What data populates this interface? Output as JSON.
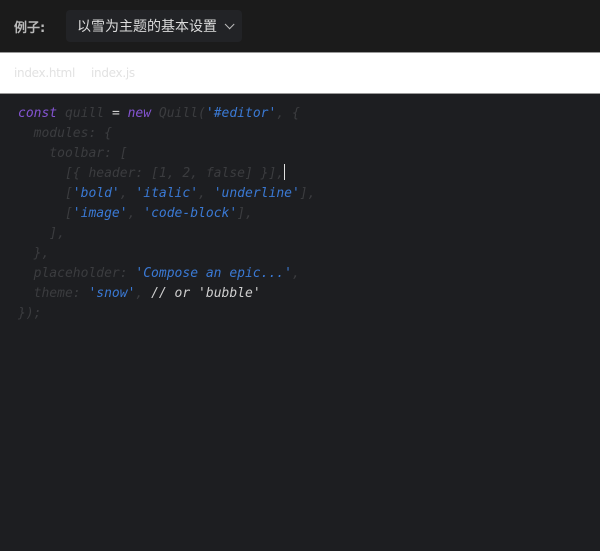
{
  "header": {
    "label": "例子:",
    "select_value": "以雪为主题的基本设置"
  },
  "tabs": [
    {
      "label": "index.html"
    },
    {
      "label": "index.js"
    }
  ],
  "code_lines": [
    [
      [
        "kw",
        "const"
      ],
      [
        "dim",
        " quill "
      ],
      [
        "op",
        "= "
      ],
      [
        "kw",
        "new"
      ],
      [
        "dim",
        " Quill("
      ],
      [
        "str",
        "'#editor'"
      ],
      [
        "dim",
        ", {"
      ]
    ],
    [
      [
        "dim",
        "  modules: {"
      ]
    ],
    [
      [
        "dim",
        "    toolbar: ["
      ]
    ],
    [
      [
        "dim",
        "      [{ header: [1, 2, false] }],"
      ],
      [
        "cursor",
        ""
      ]
    ],
    [
      [
        "dim",
        "      ["
      ],
      [
        "str",
        "'bold'"
      ],
      [
        "dim",
        ", "
      ],
      [
        "str",
        "'italic'"
      ],
      [
        "dim",
        ", "
      ],
      [
        "str",
        "'underline'"
      ],
      [
        "dim",
        "],"
      ]
    ],
    [
      [
        "dim",
        "      ["
      ],
      [
        "str",
        "'image'"
      ],
      [
        "dim",
        ", "
      ],
      [
        "str",
        "'code-block'"
      ],
      [
        "dim",
        "],"
      ]
    ],
    [
      [
        "dim",
        "    ],"
      ]
    ],
    [
      [
        "dim",
        "  },"
      ]
    ],
    [
      [
        "dim",
        "  placeholder: "
      ],
      [
        "str",
        "'Compose an epic...'"
      ],
      [
        "dim",
        ","
      ]
    ],
    [
      [
        "dim",
        "  theme: "
      ],
      [
        "str",
        "'snow'"
      ],
      [
        "dim",
        ", "
      ],
      [
        "txt",
        "// or 'bubble'"
      ]
    ],
    [
      [
        "dim",
        "});"
      ]
    ]
  ]
}
